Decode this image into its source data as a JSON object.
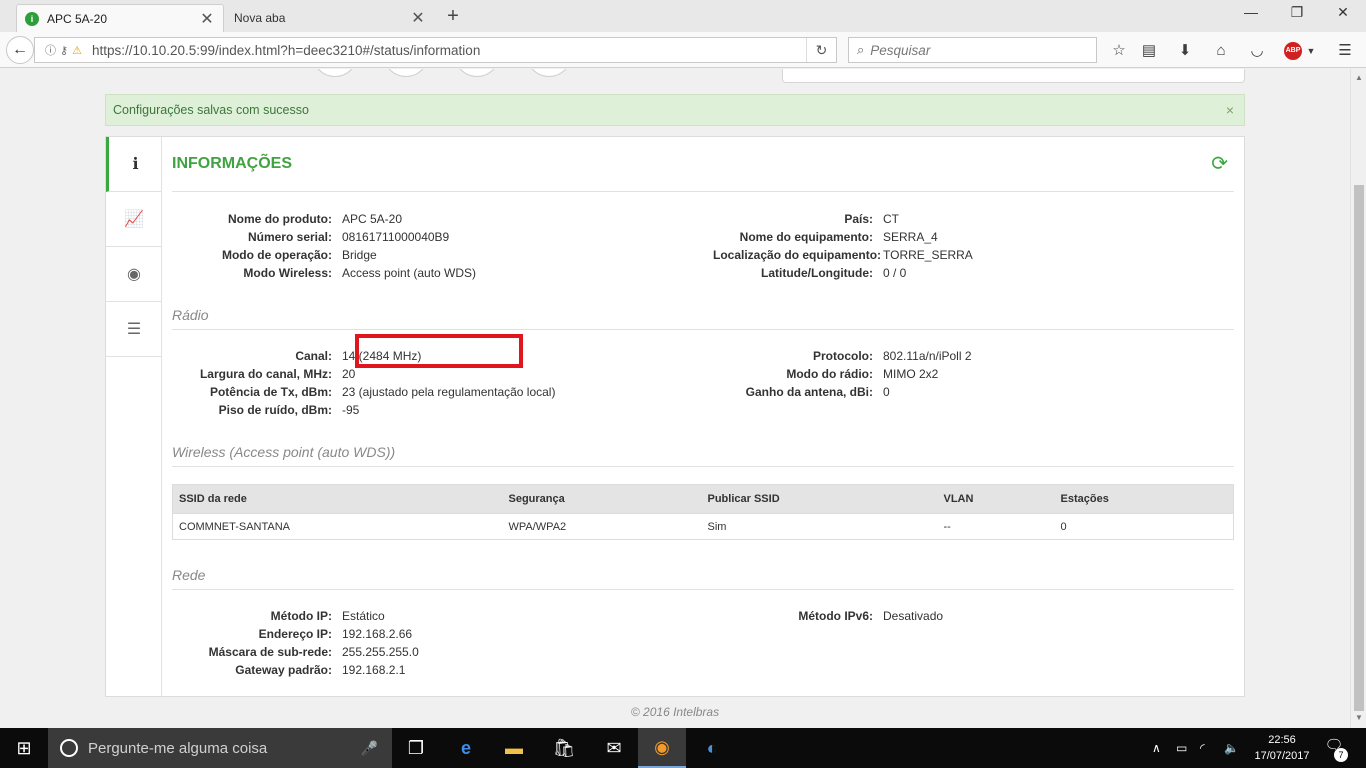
{
  "browser": {
    "tabs": [
      {
        "title": "APC 5A-20"
      },
      {
        "title": "Nova aba"
      }
    ],
    "url": "https://10.10.20.5:99/index.html?h=deec3210#/status/information",
    "search_placeholder": "Pesquisar",
    "addon_label": "ABP"
  },
  "alert": {
    "message": "Configurações salvas com sucesso",
    "close": "×"
  },
  "panel": {
    "title": "INFORMAÇÕES",
    "nav_items": [
      "info-icon",
      "chart-icon",
      "wireless-icon",
      "list-icon"
    ]
  },
  "info": {
    "left": [
      {
        "label": "Nome do produto:",
        "value": "APC 5A-20"
      },
      {
        "label": "Número serial:",
        "value": "08161711000040B9"
      },
      {
        "label": "Modo de operação:",
        "value": "Bridge"
      },
      {
        "label": "Modo Wireless:",
        "value": "Access point (auto WDS)"
      }
    ],
    "right": [
      {
        "label": "País:",
        "value": "CT"
      },
      {
        "label": "Nome do equipamento:",
        "value": "SERRA_4"
      },
      {
        "label": "Localização do equipamento:",
        "value": "TORRE_SERRA"
      },
      {
        "label": "Latitude/Longitude:",
        "value": "0 / 0"
      }
    ]
  },
  "radio": {
    "section_title": "Rádio",
    "left": [
      {
        "label": "Canal:",
        "value": "14 (2484 MHz)"
      },
      {
        "label": "Largura do canal, MHz:",
        "value": "20"
      },
      {
        "label": "Potência de Tx, dBm:",
        "value": "23 (ajustado pela regulamentação local)"
      },
      {
        "label": "Piso de ruído, dBm:",
        "value": "-95"
      }
    ],
    "right": [
      {
        "label": "Protocolo:",
        "value": "802.11a/n/iPoll 2"
      },
      {
        "label": "Modo do rádio:",
        "value": "MIMO 2x2"
      },
      {
        "label": "Ganho da antena, dBi:",
        "value": "0"
      }
    ]
  },
  "wireless": {
    "section_title": "Wireless (Access point (auto WDS))",
    "columns": [
      "SSID da rede",
      "Segurança",
      "Publicar SSID",
      "VLAN",
      "Estações"
    ],
    "rows": [
      [
        "COMMNET-SANTANA",
        "WPA/WPA2",
        "Sim",
        "--",
        "0"
      ]
    ]
  },
  "network": {
    "section_title": "Rede",
    "left": [
      {
        "label": "Método IP:",
        "value": "Estático"
      },
      {
        "label": "Endereço IP:",
        "value": "192.168.2.66"
      },
      {
        "label": "Máscara de sub-rede:",
        "value": "255.255.255.0"
      },
      {
        "label": "Gateway padrão:",
        "value": "192.168.2.1"
      }
    ],
    "right": [
      {
        "label": "Método IPv6:",
        "value": "Desativado"
      }
    ]
  },
  "footer": "© 2016 Intelbras",
  "taskbar": {
    "search_placeholder": "Pergunte-me alguma coisa",
    "time": "22:56",
    "date": "17/07/2017",
    "notification_count": "7"
  },
  "colors": {
    "accent_green": "#3fa33f",
    "alert_bg": "#dff0d8",
    "highlight_red": "#e0151d"
  }
}
